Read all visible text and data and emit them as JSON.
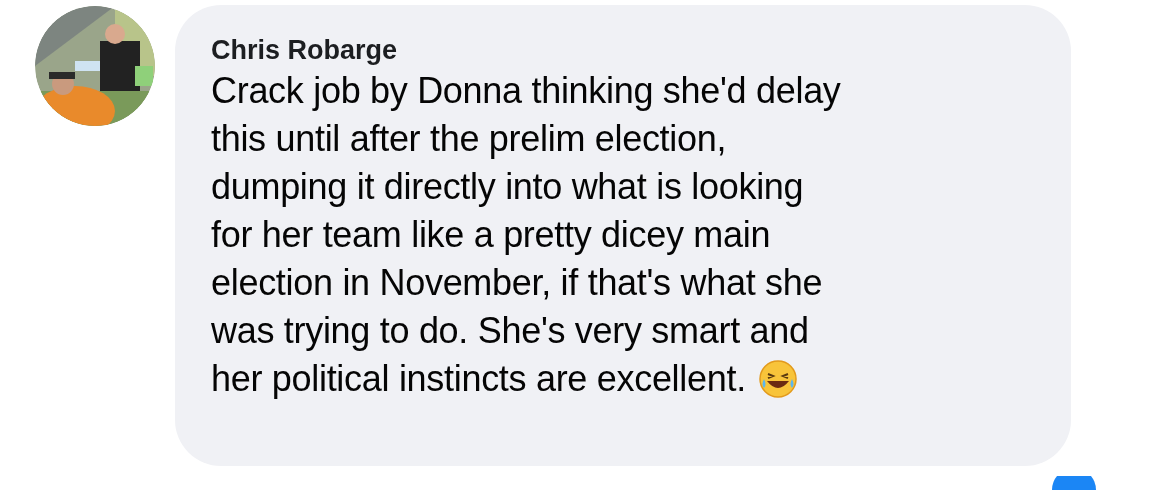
{
  "comment": {
    "author": "Chris Robarge",
    "lines": [
      "Crack job by Donna thinking she'd delay",
      "this until after the prelim election,",
      "dumping it directly into what is looking",
      "for her team like a pretty dicey main",
      "election in November, if that's what she",
      "was trying to do. She's very smart and",
      "her political instincts are excellent."
    ]
  }
}
